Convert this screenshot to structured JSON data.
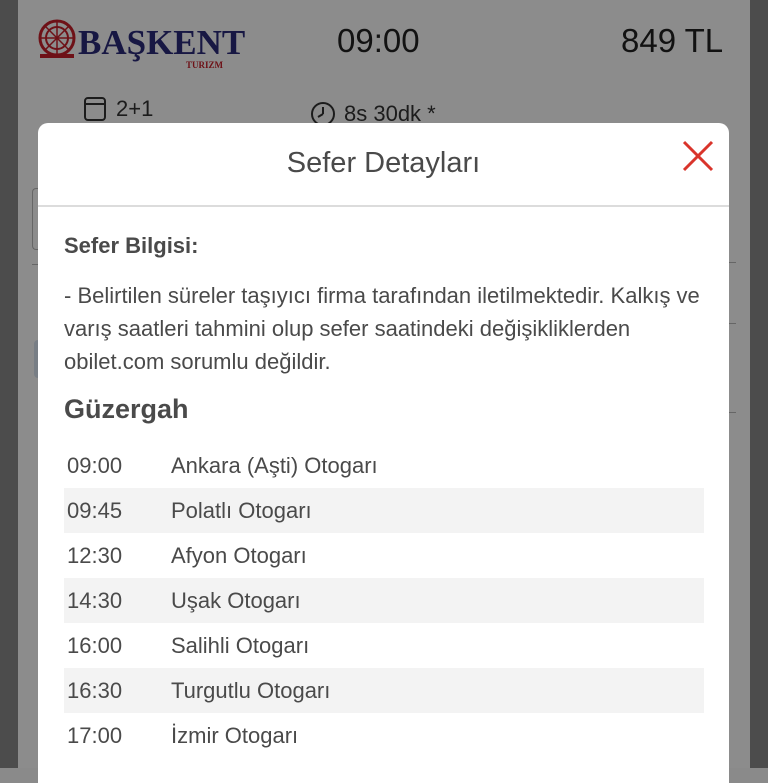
{
  "trip": {
    "brand_name": "BAŞKENT",
    "brand_sub": "TURIZM",
    "departure_time": "09:00",
    "price": "849 TL",
    "seat_layout": "2+1",
    "duration": "8s 30dk *"
  },
  "modal": {
    "title": "Sefer Detayları",
    "info_heading": "Sefer Bilgisi:",
    "info_text": "- Belirtilen süreler taşıyıcı firma tarafından iletilmektedir. Kalkış ve varış saatleri tahmini olup sefer saatindeki değişikliklerden obilet.com sorumlu değildir.",
    "route_heading": "Güzergah",
    "route": [
      {
        "time": "09:00",
        "place": "Ankara (Aşti) Otogarı"
      },
      {
        "time": "09:45",
        "place": "Polatlı Otogarı"
      },
      {
        "time": "12:30",
        "place": "Afyon Otogarı"
      },
      {
        "time": "14:30",
        "place": "Uşak Otogarı"
      },
      {
        "time": "16:00",
        "place": "Salihli Otogarı"
      },
      {
        "time": "16:30",
        "place": "Turgutlu Otogarı"
      },
      {
        "time": "17:00",
        "place": "İzmir Otogarı"
      }
    ]
  },
  "colors": {
    "brand_navy": "#2b2a7a",
    "brand_red": "#c8202a",
    "close_red": "#d9342b",
    "text": "#4a4a4a"
  }
}
